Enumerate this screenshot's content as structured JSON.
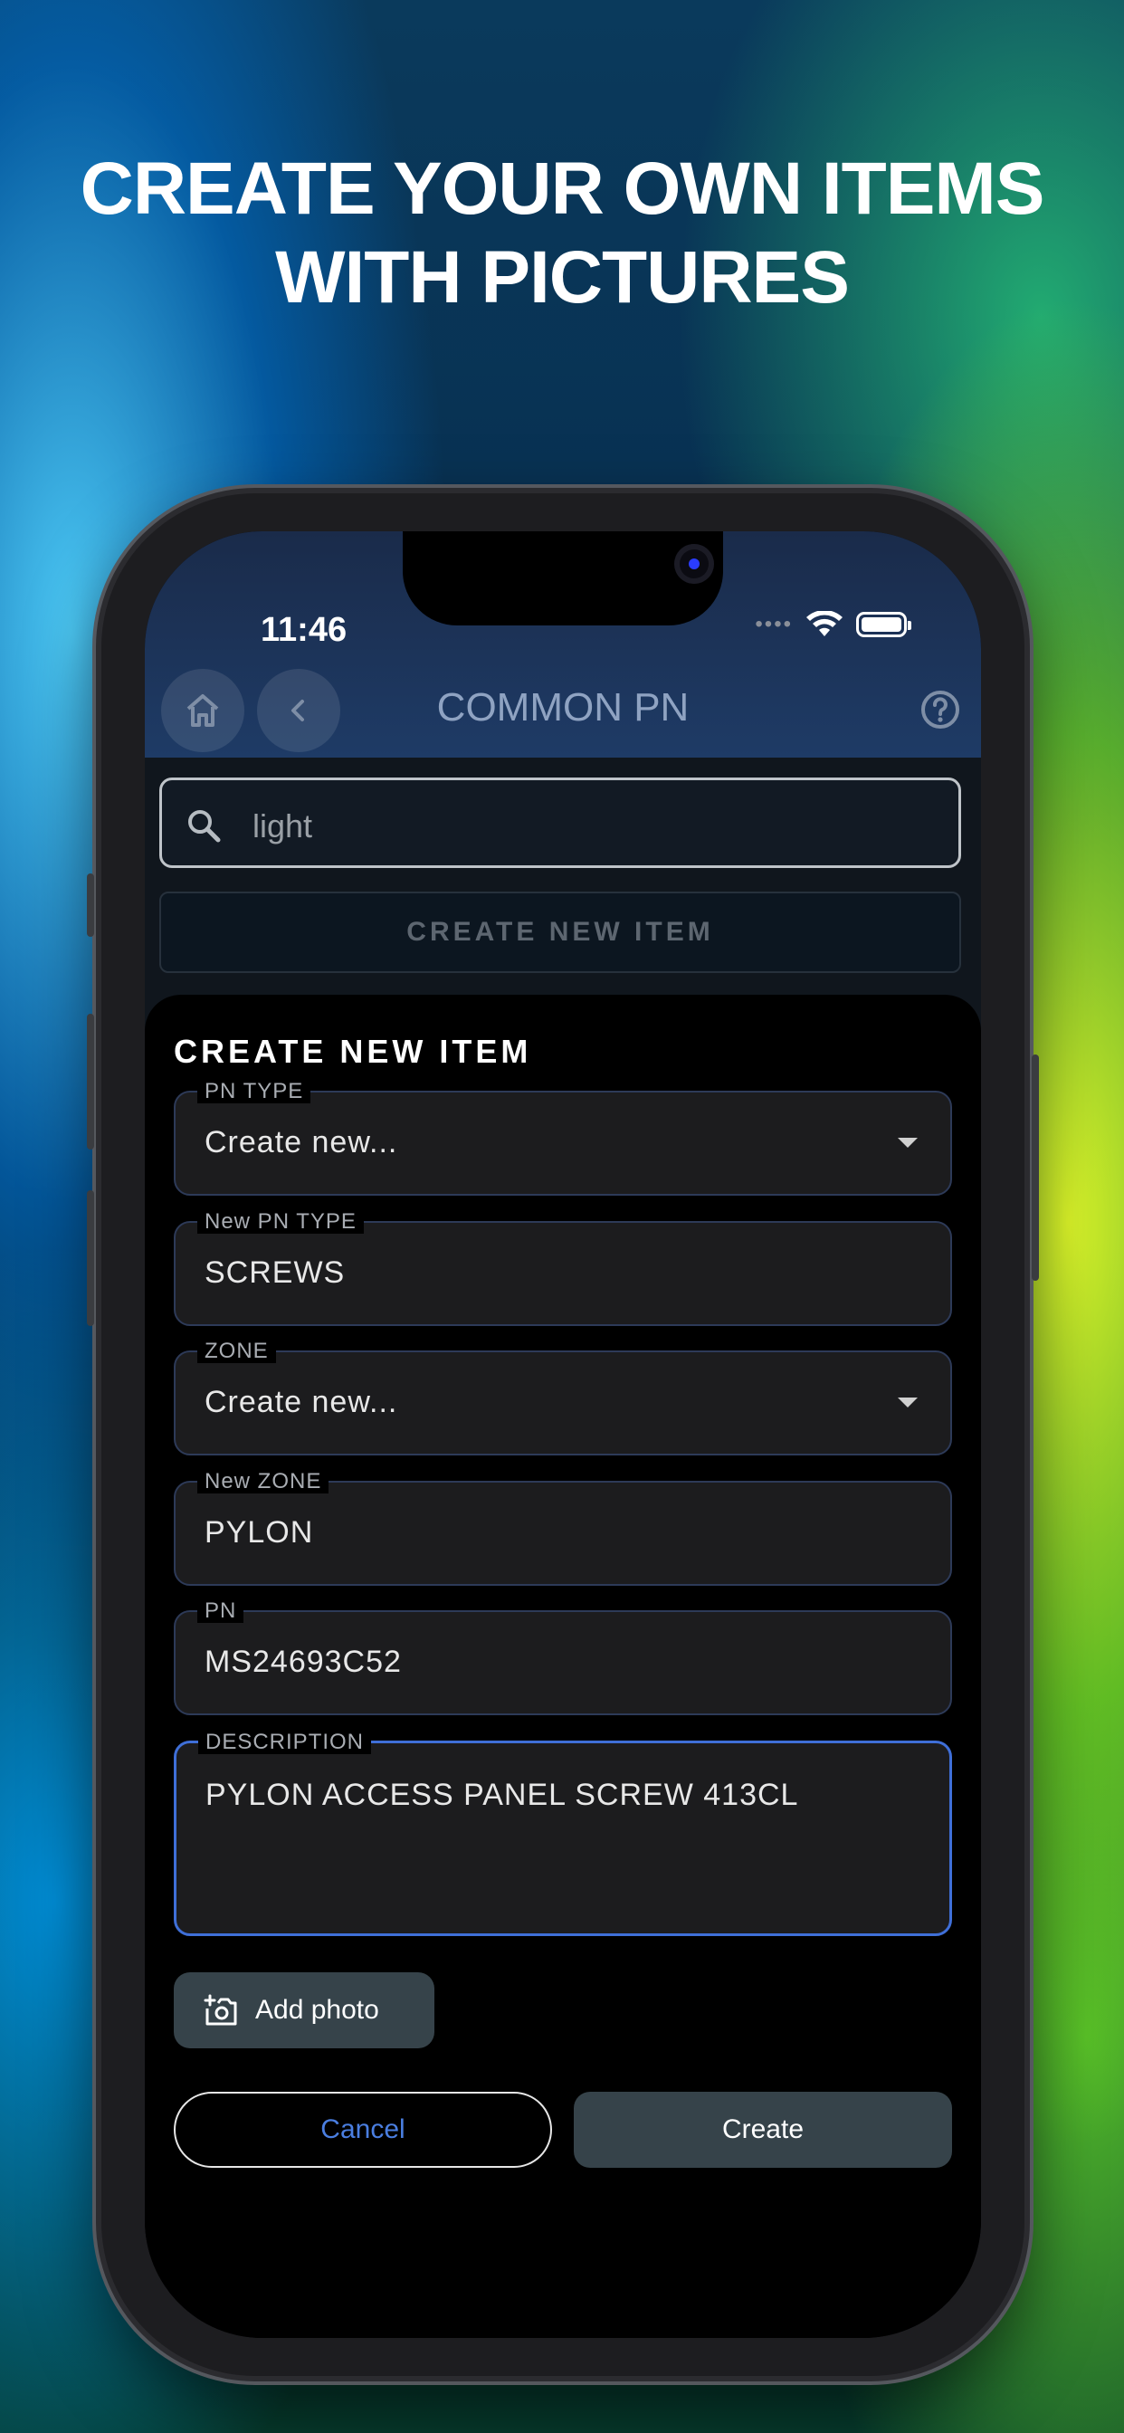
{
  "headline": {
    "line1": "CREATE YOUR OWN ITEMS",
    "line2": "WITH PICTURES"
  },
  "status_bar": {
    "time": "11:46",
    "icons": [
      "signal-dots",
      "wifi-icon",
      "battery-icon"
    ]
  },
  "app_bar": {
    "title": "COMMON PN",
    "home_icon": "home-icon",
    "back_icon": "chevron-left-icon",
    "help_icon": "help-circle-icon"
  },
  "search": {
    "value": "light",
    "icon": "search-icon"
  },
  "create_strip_label": "CREATE NEW ITEM",
  "sheet": {
    "title": "CREATE NEW ITEM",
    "fields": {
      "pn_type": {
        "label": "PN TYPE",
        "value": "Create new...",
        "type": "select"
      },
      "new_pn_type": {
        "label": "New PN TYPE",
        "value": "SCREWS"
      },
      "zone": {
        "label": "ZONE",
        "value": "Create new...",
        "type": "select"
      },
      "new_zone": {
        "label": "New ZONE",
        "value": "PYLON"
      },
      "pn": {
        "label": "PN",
        "value": "MS24693C52"
      },
      "description": {
        "label": "DESCRIPTION",
        "value": "PYLON ACCESS PANEL SCREW 413CL"
      }
    },
    "add_photo_label": "Add photo",
    "cancel_label": "Cancel",
    "create_label": "Create"
  },
  "colors": {
    "accent_blue": "#3f6fd8",
    "cancel_text": "#4a7ee0",
    "button_bg": "#36434a",
    "sheet_bg": "#000000",
    "field_bg": "#1c1c1e"
  }
}
